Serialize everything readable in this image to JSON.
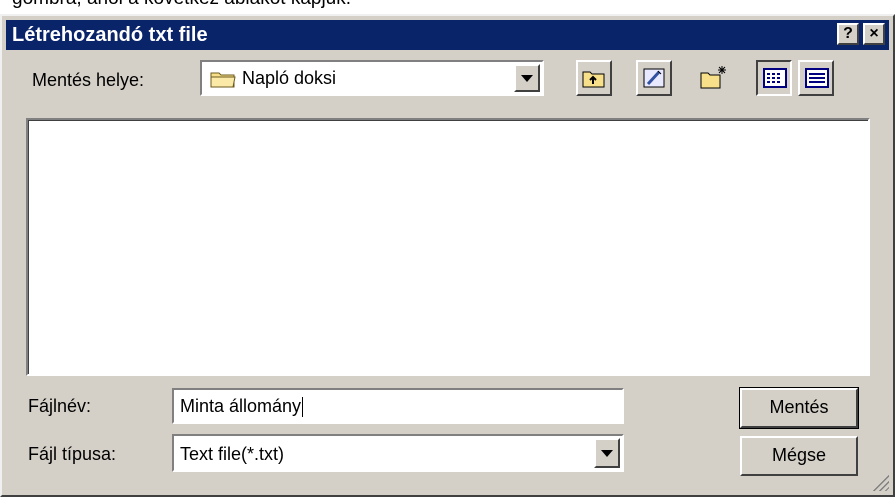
{
  "background_text": "gombra, ahol a következ ablakot kapjuk.",
  "dialog": {
    "title": "Létrehozandó txt file",
    "help_button": "?",
    "close_button": "×"
  },
  "location": {
    "label": "Mentés helye:",
    "value": "Napló doksi"
  },
  "toolbar": {
    "icons": [
      "up-one-level-icon",
      "desktop-icon",
      "new-folder-icon",
      "list-view-icon",
      "details-view-icon"
    ]
  },
  "filename": {
    "label": "Fájlnév:",
    "value": "Minta állomány"
  },
  "filetype": {
    "label": "Fájl típusa:",
    "value": "Text file(*.txt)"
  },
  "buttons": {
    "save": "Mentés",
    "cancel": "Mégse"
  },
  "colors": {
    "titlebar": "#0a246a",
    "face": "#d4d0c8"
  }
}
